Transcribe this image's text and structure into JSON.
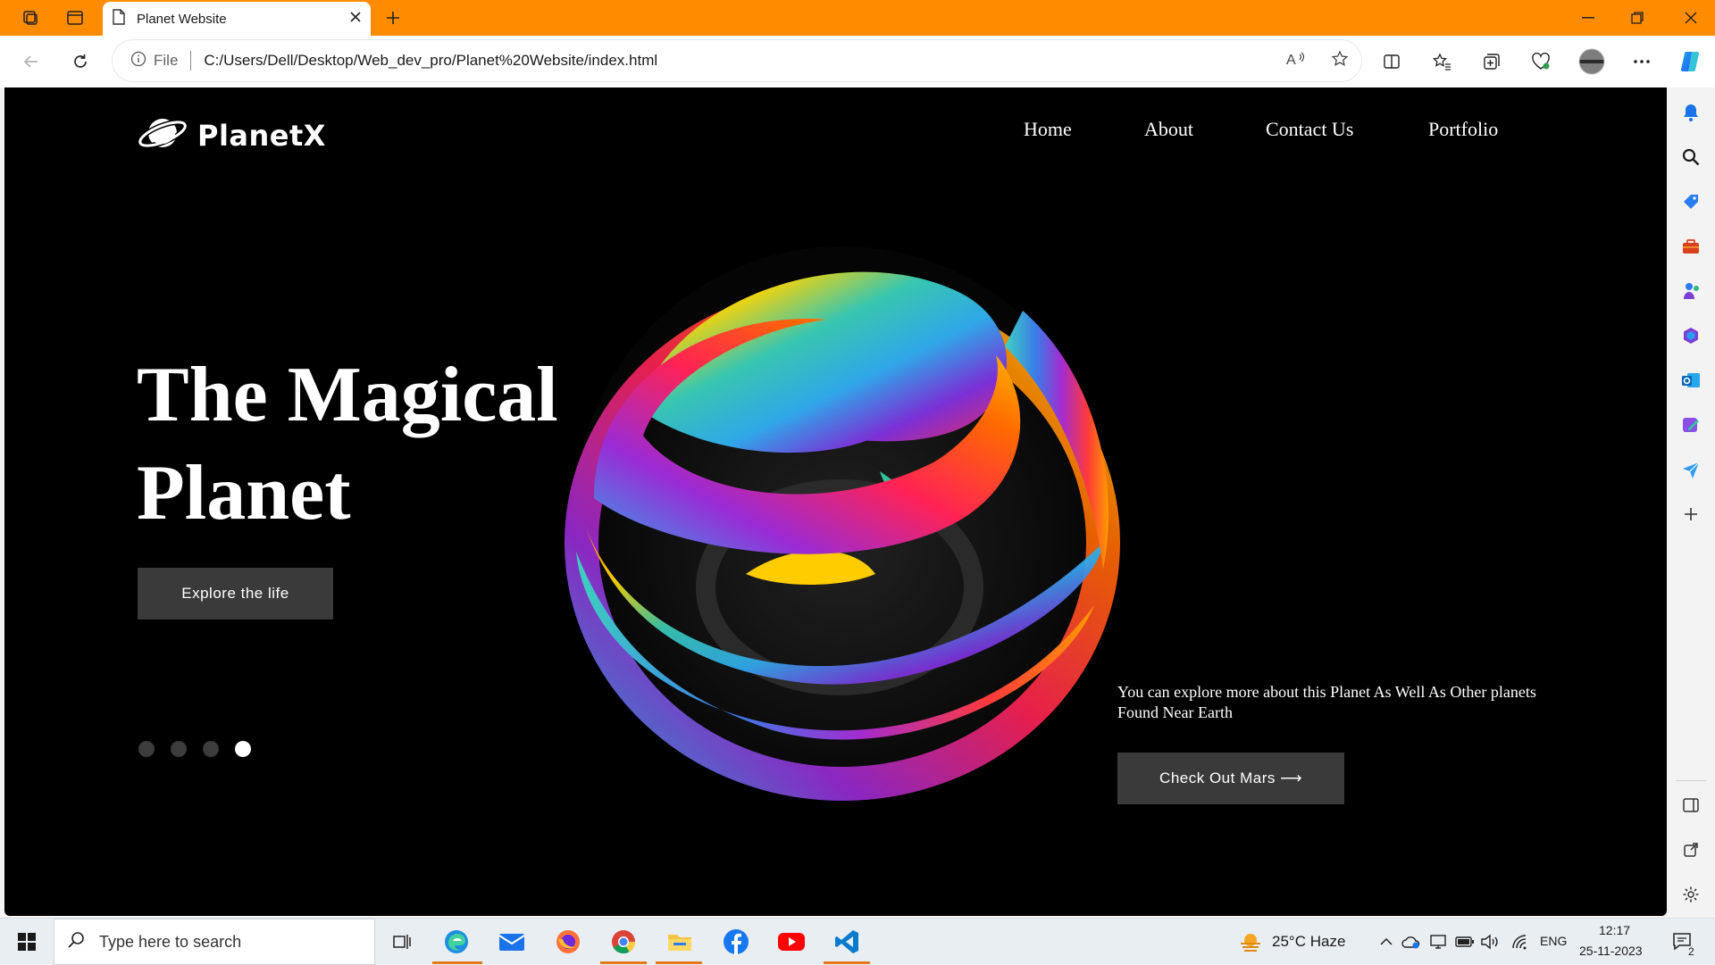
{
  "browser": {
    "tab_title": "Planet Website",
    "address_prefix": "File",
    "url": "C:/Users/Dell/Desktop/Web_dev_pro/Planet%20Website/index.html"
  },
  "site": {
    "logo": "PlanetX",
    "nav": [
      "Home",
      "About",
      "Contact Us",
      "Portfolio"
    ],
    "hero_line1": "The Magical",
    "hero_line2": "Planet",
    "explore_button": "Explore the life",
    "description": "You can explore more about this Planet As Well As Other planets Found Near Earth",
    "cta_button": "Check Out Mars ⟶",
    "slider": {
      "count": 4,
      "active_index": 4
    }
  },
  "taskbar": {
    "search_placeholder": "Type here to search",
    "weather": "25°C  Haze",
    "language": "ENG",
    "time": "12:17",
    "date": "25-11-2023",
    "notification_count": "2"
  },
  "colors": {
    "titlebar": "#ff8c00",
    "page_bg": "#000000",
    "button_bg": "#3a3a3a"
  }
}
